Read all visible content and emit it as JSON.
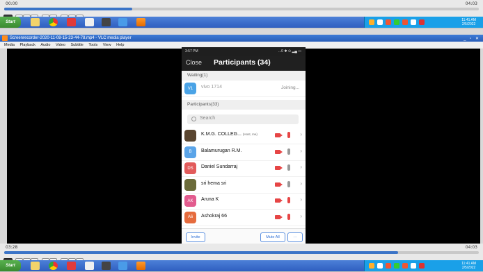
{
  "top_player": {
    "time_left": "00:00",
    "time_right": "04:03"
  },
  "bottom_player": {
    "time_left": "03:28",
    "time_right": "04:03"
  },
  "taskbar": {
    "start": "Start",
    "clock_time": "11:41 AM",
    "clock_date": "2/5/2022"
  },
  "taskbar_bottom": {
    "clock_time": "11:41 AM",
    "clock_date": "2/5/2022"
  },
  "vlc": {
    "title": "Screenrecorder-2020-11-08-15-23-44-78.mp4 - VLC media player",
    "menu": [
      "Media",
      "Playback",
      "Audio",
      "Video",
      "Subtitle",
      "Tools",
      "View",
      "Help"
    ]
  },
  "phone": {
    "status_time": "3:57 PM",
    "status_right": "...0 ✱ ⊙ ▂▄ ▭",
    "close_label": "Close",
    "title": "Participants (34)",
    "waiting_header": "Waiting(1)",
    "waiting": {
      "initials": "V1",
      "name": "vivo 1714",
      "status": "Joining..."
    },
    "participants_header": "Participants(33)",
    "search_placeholder": "Search",
    "participants": [
      {
        "initials": "",
        "name": "K.M.G. COLLEG...",
        "tag": "(Host, me)",
        "color": "#5a4630",
        "mic_muted": true
      },
      {
        "initials": "B",
        "name": "Balamurugan R.M.",
        "tag": "",
        "color": "#5aa4e8",
        "mic_muted": false
      },
      {
        "initials": "DS",
        "name": "Daniel Sundarraj",
        "tag": "",
        "color": "#e25b5b",
        "mic_muted": false
      },
      {
        "initials": "",
        "name": "sri hema sri",
        "tag": "",
        "color": "#6b6b3a",
        "mic_muted": false
      },
      {
        "initials": "AK",
        "name": "Aruna K",
        "tag": "",
        "color": "#e25b8e",
        "mic_muted": true
      },
      {
        "initials": "A6",
        "name": "Ashokraj 66",
        "tag": "",
        "color": "#e56b3d",
        "mic_muted": true
      }
    ],
    "invite_label": "Invite",
    "mute_all_label": "Mute All",
    "more_label": "···"
  }
}
